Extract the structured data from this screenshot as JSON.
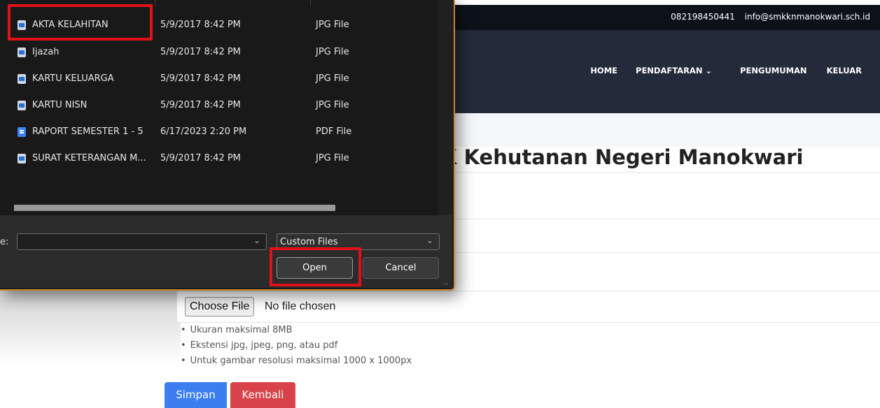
{
  "website": {
    "topbar": {
      "phone": "082198450441",
      "email": "info@smkknmanokwari.sch.id"
    },
    "nav": {
      "home": "HOME",
      "pendaftaran": "PENDAFTARAN",
      "pendaftaran_chevron": "⌄",
      "pengumuman": "PENGUMUMAN",
      "keluar": "KELUAR"
    },
    "page_title": "K Kehutanan Negeri Manokwari",
    "file_input": {
      "button_label": "Choose File",
      "status": "No file chosen"
    },
    "hints": [
      "Ukuran maksimal 8MB",
      "Ekstensi jpg, jpeg, png, atau pdf",
      "Untuk gambar resolusi maksimal 1000 x 1000px"
    ],
    "buttons": {
      "save": "Simpan",
      "back": "Kembali"
    }
  },
  "dialog": {
    "files": [
      {
        "name": "AKTA KELAHITAN",
        "date": "5/9/2017 8:42 PM",
        "type": "JPG File",
        "icon": "image-file-icon"
      },
      {
        "name": "Ijazah",
        "date": "5/9/2017 8:42 PM",
        "type": "JPG File",
        "icon": "image-file-icon"
      },
      {
        "name": "KARTU KELUARGA",
        "date": "5/9/2017 8:42 PM",
        "type": "JPG File",
        "icon": "image-file-icon"
      },
      {
        "name": "KARTU NISN",
        "date": "5/9/2017 8:42 PM",
        "type": "JPG File",
        "icon": "image-file-icon"
      },
      {
        "name": "RAPORT SEMESTER 1 - 5",
        "date": "6/17/2023 2:20 PM",
        "type": "PDF File",
        "icon": "pdf-file-icon"
      },
      {
        "name": "SURAT KETERANGAN M...",
        "date": "5/9/2017 8:42 PM",
        "type": "JPG File",
        "icon": "image-file-icon"
      }
    ],
    "file_name_label": "e:",
    "file_name_value": "",
    "file_type": "Custom Files",
    "chevron": "⌄",
    "open_label": "Open",
    "cancel_label": "Cancel",
    "grip": "⣀"
  },
  "colors": {
    "highlight": "#e0111a",
    "dialog_border": "#c9862c",
    "save_button": "#3c7df0",
    "back_button": "#d8434b"
  }
}
